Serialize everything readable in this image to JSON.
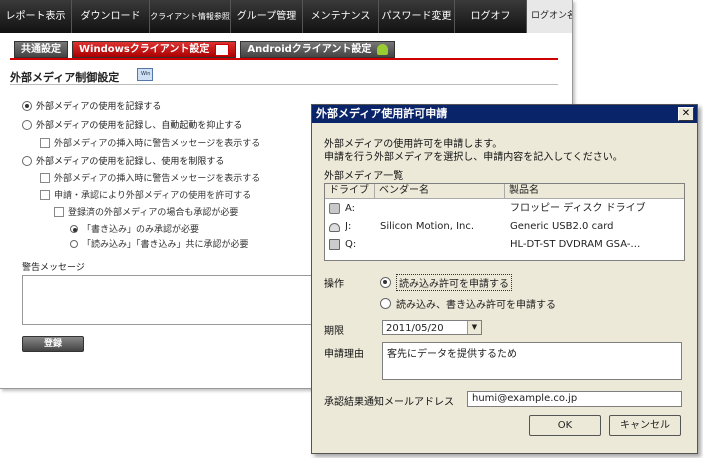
{
  "nav": {
    "items": [
      "レポート表示",
      "ダウンロード",
      "クライアント情報参照",
      "グループ管理",
      "メンテナンス",
      "パスワード変更",
      "ログオフ"
    ],
    "user": "ログオン名"
  },
  "subtabs": {
    "common": "共通設定",
    "windows": "Windowsクライアント設定",
    "android": "Androidクライアント設定"
  },
  "section": {
    "title": "外部メディア制御設定",
    "icon_caption": "Win"
  },
  "options": {
    "record": "外部メディアの使用を記録する",
    "record_block_autorun": "外部メディアの使用を記録し、自動起動を抑止する",
    "warn_on_insert_1": "外部メディアの挿入時に警告メッセージを表示する",
    "record_restrict": "外部メディアの使用を記録し、使用を制限する",
    "warn_on_insert_2": "外部メディアの挿入時に警告メッセージを表示する",
    "allow_by_request": "申請・承認により外部メディアの使用を許可する",
    "registered_need_approval": "登録済の外部メディアの場合も承認が必要",
    "write_only": "「書き込み」のみ承認が必要",
    "read_write": "「読み込み」「書き込み」共に承認が必要",
    "warning_label": "警告メッセージ",
    "register_button": "登録"
  },
  "dialog": {
    "title": "外部メディア使用許可申請",
    "close_symbol": "✕",
    "desc_line1": "外部メディアの使用許可を申請します。",
    "desc_line2": "申請を行う外部メディアを選択し、申請内容を記入してください。",
    "list_label": "外部メディア一覧",
    "columns": [
      "ドライブ",
      "ベンダー名",
      "製品名"
    ],
    "rows": [
      {
        "drive": "A:",
        "vendor": "",
        "product": "フロッピー ディスク ドライブ",
        "icon": "usb-drive-icon"
      },
      {
        "drive": "J:",
        "vendor": "Silicon Motion, Inc.",
        "product": "Generic USB2.0 card",
        "icon": "disk-drive-icon"
      },
      {
        "drive": "Q:",
        "vendor": "",
        "product": "HL-DT-ST DVDRAM GSA-…",
        "icon": "cd-drive-icon"
      }
    ],
    "operation_label": "操作",
    "op_read": "読み込み許可を申請する",
    "op_readwrite": "読み込み、書き込み許可を申請する",
    "deadline_label": "期限",
    "deadline_value": "2011/05/20",
    "reason_label": "申請理由",
    "reason_value": "客先にデータを提供するため",
    "email_label": "承認結果通知メールアドレス",
    "email_value": "humi@example.co.jp",
    "ok": "OK",
    "cancel": "キャンセル"
  }
}
